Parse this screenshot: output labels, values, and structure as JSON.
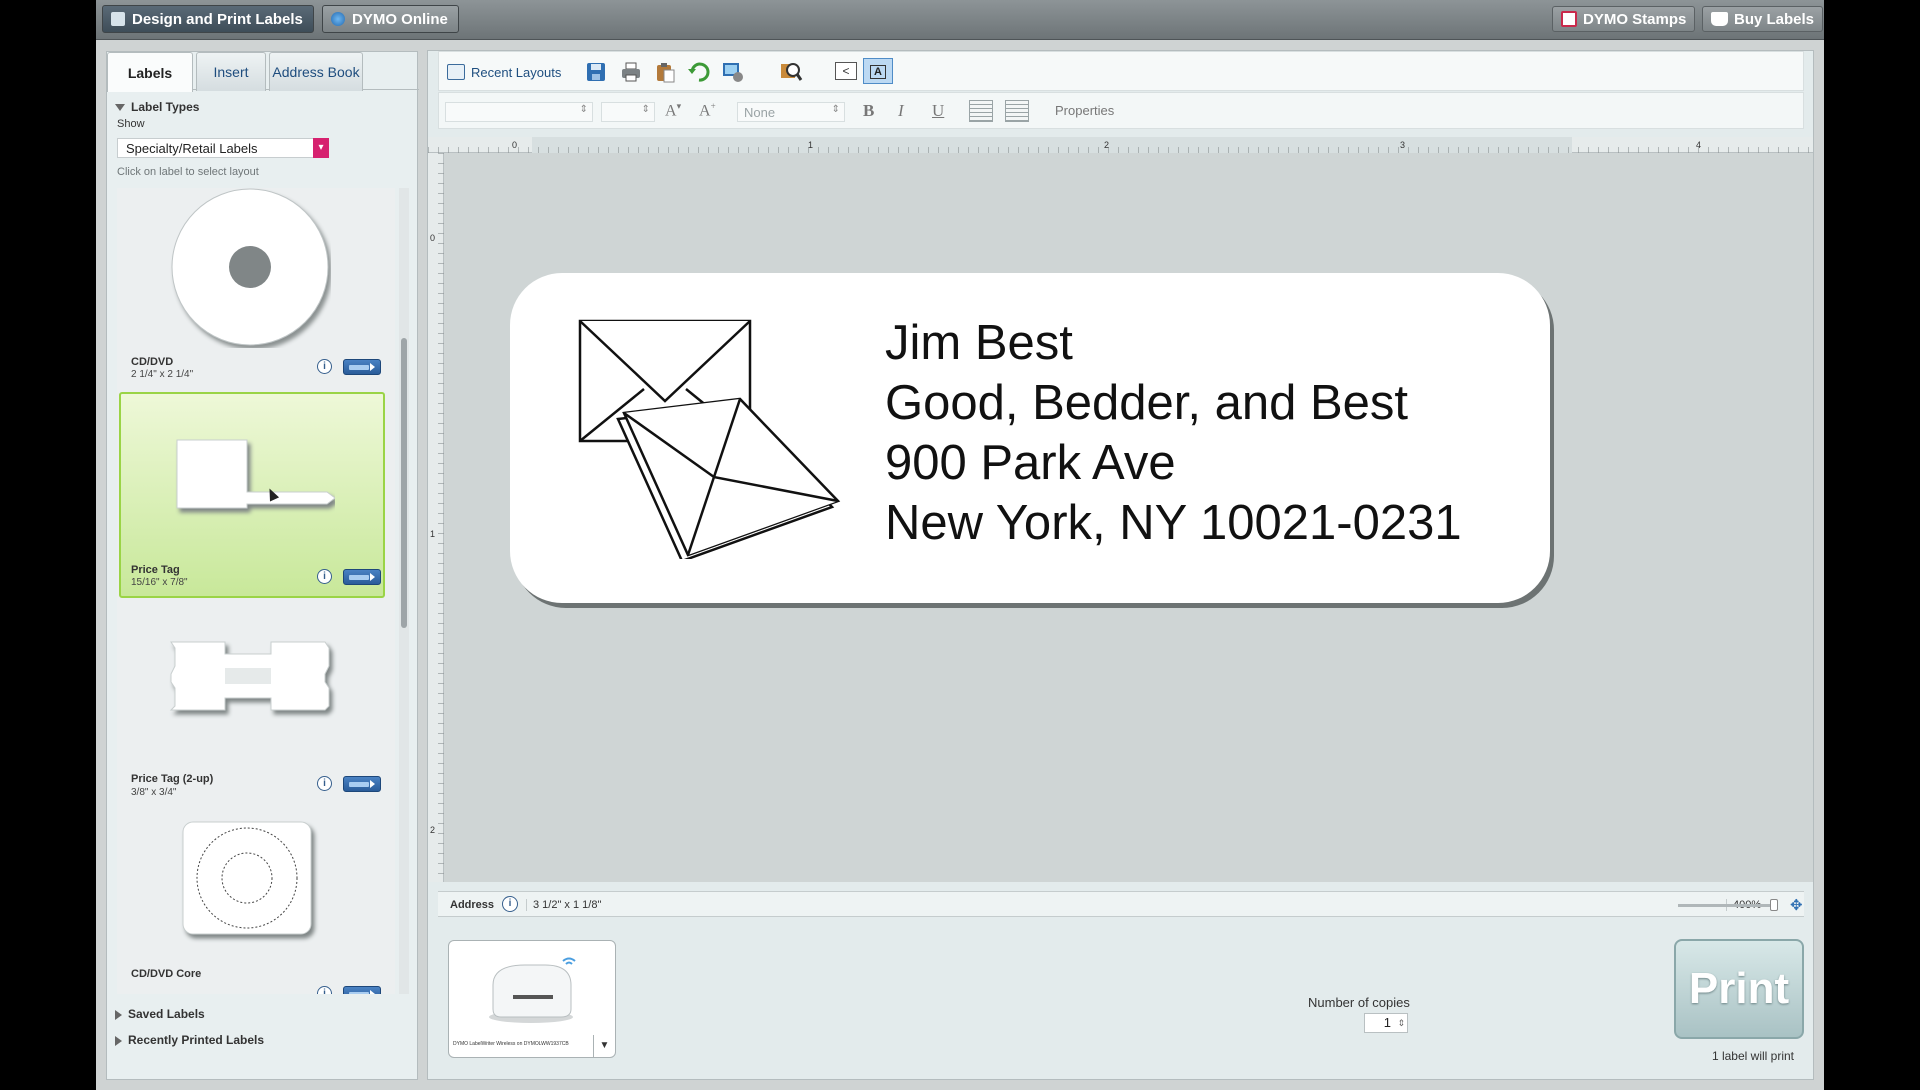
{
  "topbar": {
    "tab_design": "Design and Print Labels",
    "tab_online": "DYMO Online",
    "stamps": "DYMO Stamps",
    "buy": "Buy Labels"
  },
  "left_panel": {
    "tabs": [
      "Labels",
      "Insert",
      "Address Book"
    ],
    "label_types_header": "Label Types",
    "show_label": "Show",
    "show_value": "Specialty/Retail Labels",
    "hint": "Click on label to select layout",
    "labels": [
      {
        "name": "CD/DVD",
        "size": "2 1/4\" x 2 1/4\""
      },
      {
        "name": "Price Tag",
        "size": "15/16\" x 7/8\""
      },
      {
        "name": "Price Tag (2-up)",
        "size": "3/8\" x 3/4\""
      },
      {
        "name": "CD/DVD Core",
        "size": ""
      }
    ],
    "saved_labels": "Saved Labels",
    "recently_printed": "Recently Printed Labels"
  },
  "toolbar": {
    "recent_layouts": "Recent Layouts",
    "font_none": "None",
    "properties": "Properties",
    "bold": "B",
    "italic": "I",
    "underline": "U"
  },
  "ruler": {
    "h_ticks": [
      "0",
      "1",
      "2",
      "3",
      "4"
    ],
    "v_ticks": [
      "0",
      "1",
      "2"
    ]
  },
  "label": {
    "lines": [
      "Jim Best",
      "Good, Bedder, and Best",
      "900 Park Ave",
      "New York, NY 10021-0231"
    ]
  },
  "status": {
    "type": "Address",
    "size": "3 1/2\" x 1 1/8\"",
    "zoom": "400%"
  },
  "print": {
    "printer_name": "DYMO LabelWriter Wireless on DYMOLWW1937CB",
    "copies_label": "Number of copies",
    "copies_value": "1",
    "button": "Print",
    "will_print": "1 label will print"
  },
  "colors": {
    "accent_pink": "#d6216f",
    "selected_green": "#9ad446"
  }
}
